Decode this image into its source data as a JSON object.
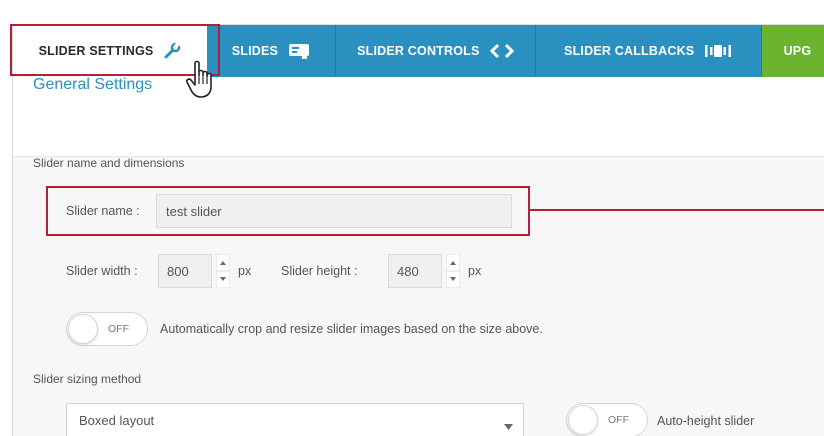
{
  "tabs": [
    {
      "label": "SLIDER SETTINGS",
      "icon": "wrench-icon",
      "active": true
    },
    {
      "label": "SLIDES",
      "icon": "slides-icon",
      "active": false
    },
    {
      "label": "SLIDER CONTROLS",
      "icon": "code-arrows-icon",
      "active": false
    },
    {
      "label": "SLIDER CALLBACKS",
      "icon": "callbacks-icon",
      "active": false
    },
    {
      "label": "UPG",
      "icon": "",
      "active": false
    }
  ],
  "section_title": "General Settings",
  "dimensions_group": {
    "label": "Slider name and dimensions",
    "name_label": "Slider name :",
    "name_value": "test slider",
    "width_label": "Slider width :",
    "width_value": "800",
    "width_unit": "px",
    "height_label": "Slider height :",
    "height_value": "480",
    "height_unit": "px",
    "crop_toggle": {
      "state": "OFF",
      "label": "Automatically crop and resize slider images based on the size above."
    }
  },
  "sizing_group": {
    "label": "Slider sizing method",
    "method_value": "Boxed layout",
    "autoheight_toggle": {
      "state": "OFF",
      "label": "Auto-height slider"
    }
  },
  "colors": {
    "tab_blue": "#2a90c0",
    "tab_green": "#6ab430",
    "highlight_red": "#b0203a",
    "link_blue": "#2a90c0"
  }
}
